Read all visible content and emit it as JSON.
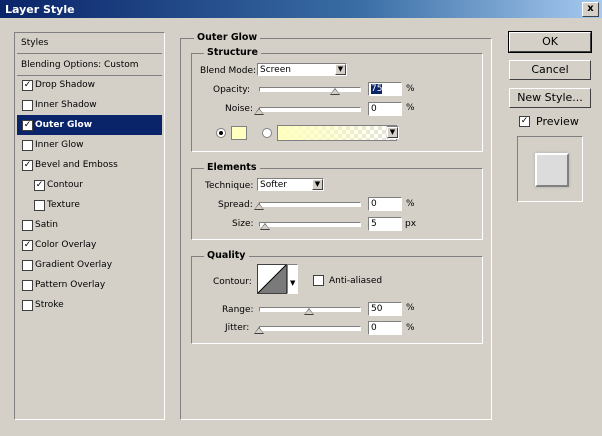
{
  "window": {
    "title": "Layer Style",
    "close_glyph": "x"
  },
  "sidebar": {
    "header": "Styles",
    "blending": "Blending Options: Custom",
    "items": [
      {
        "label": "Drop Shadow",
        "checked": true
      },
      {
        "label": "Inner Shadow",
        "checked": false
      },
      {
        "label": "Outer Glow",
        "checked": true,
        "selected": true
      },
      {
        "label": "Inner Glow",
        "checked": false
      },
      {
        "label": "Bevel and Emboss",
        "checked": true
      },
      {
        "label": "Contour",
        "checked": true,
        "indent": true
      },
      {
        "label": "Texture",
        "checked": false,
        "indent": true
      },
      {
        "label": "Satin",
        "checked": false
      },
      {
        "label": "Color Overlay",
        "checked": true
      },
      {
        "label": "Gradient Overlay",
        "checked": false
      },
      {
        "label": "Pattern Overlay",
        "checked": false
      },
      {
        "label": "Stroke",
        "checked": false
      }
    ]
  },
  "panel": {
    "title": "Outer Glow",
    "structure": {
      "legend": "Structure",
      "blend_mode_label": "Blend Mode:",
      "blend_mode_value": "Screen",
      "opacity_label": "Opacity:",
      "opacity_value": "75",
      "opacity_unit": "%",
      "noise_label": "Noise:",
      "noise_value": "0",
      "noise_unit": "%"
    },
    "elements": {
      "legend": "Elements",
      "technique_label": "Technique:",
      "technique_value": "Softer",
      "spread_label": "Spread:",
      "spread_value": "0",
      "spread_unit": "%",
      "size_label": "Size:",
      "size_value": "5",
      "size_unit": "px"
    },
    "quality": {
      "legend": "Quality",
      "contour_label": "Contour:",
      "anti_aliased_label": "Anti-aliased",
      "range_label": "Range:",
      "range_value": "50",
      "range_unit": "%",
      "jitter_label": "Jitter:",
      "jitter_value": "0",
      "jitter_unit": "%"
    }
  },
  "buttons": {
    "ok": "OK",
    "cancel": "Cancel",
    "new_style": "New Style..."
  },
  "preview": {
    "label": "Preview",
    "checked": true
  },
  "colors": {
    "glow": "#ffffc0",
    "selection": "#0a246a",
    "face": "#d4d0c8"
  }
}
